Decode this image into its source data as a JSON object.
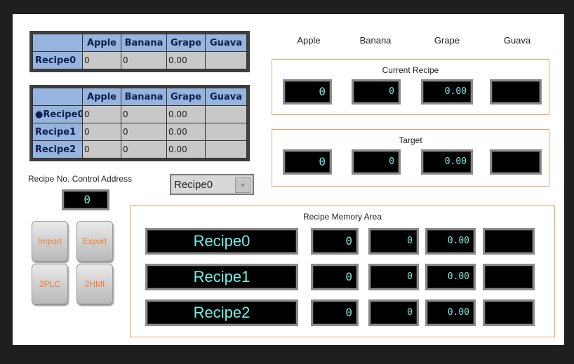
{
  "table_single": {
    "columns": [
      "",
      "Apple",
      "Banana",
      "Grape",
      "Guava"
    ],
    "rows": [
      {
        "name": "Recipe0",
        "values": [
          "0",
          "0",
          "0.00",
          ""
        ]
      }
    ]
  },
  "table_multi": {
    "columns": [
      "",
      "Apple",
      "Banana",
      "Grape",
      "Guava"
    ],
    "rows": [
      {
        "name": "●Recipe0",
        "values": [
          "0",
          "0",
          "0.00",
          ""
        ]
      },
      {
        "name": "Recipe1",
        "values": [
          "0",
          "0",
          "0.00",
          ""
        ]
      },
      {
        "name": "Recipe2",
        "values": [
          "0",
          "0",
          "0.00",
          ""
        ]
      }
    ]
  },
  "column_headers": [
    "Apple",
    "Banana",
    "Grape",
    "Guava"
  ],
  "current_recipe": {
    "title": "Current Recipe",
    "values": [
      "0",
      "0",
      "0.00",
      ""
    ]
  },
  "target": {
    "title": "Target",
    "values": [
      "0",
      "0",
      "0.00",
      ""
    ]
  },
  "control": {
    "label": "Recipe No. Control Address",
    "value": "0"
  },
  "combo": {
    "selected": "Recipe0"
  },
  "buttons": {
    "import": "Import",
    "export": "Export",
    "to_plc": "2PLC",
    "to_hmi": "2HMI"
  },
  "memory": {
    "title": "Recipe Memory Area",
    "rows": [
      {
        "name": "Recipe0",
        "values": [
          "0",
          "0",
          "0.00",
          ""
        ]
      },
      {
        "name": "Recipe1",
        "values": [
          "0",
          "0",
          "0.00",
          ""
        ]
      },
      {
        "name": "Recipe2",
        "values": [
          "0",
          "0",
          "0.00",
          ""
        ]
      }
    ]
  },
  "colors": {
    "accent_border": "#e8a064",
    "lcd_text": "#7fe6e0",
    "table_header": "#96b4de",
    "button_text": "#f07a2c"
  }
}
